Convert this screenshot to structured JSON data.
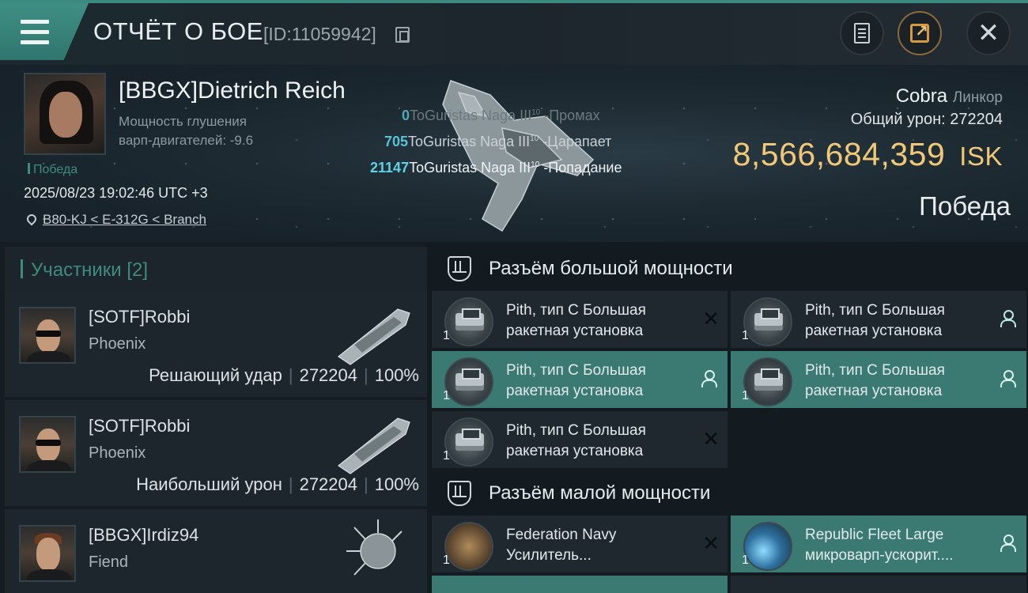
{
  "topbar": {
    "title": "ОТЧЁТ О БОЕ",
    "report_id": "[ID:11059942]"
  },
  "victim": {
    "name": "[BBGX]Dietrich Reich",
    "stat_label": "Мощность глушения",
    "stat_label_2": "варп-двигателей: -9.6",
    "result_tag": "Победа",
    "datetime": "2025/08/23 19:02:46 UTC +3",
    "location": "B80-KJ < E-312G < Branch",
    "ship_name": "Cobra",
    "ship_class": "Линкор",
    "total_damage_label": "Общий урон:",
    "total_damage": "272204",
    "isk_value": "8,566,684,359",
    "isk_unit": "ISK",
    "outcome": "Победа"
  },
  "hits": [
    {
      "damage": "0",
      "target": "ToGuristas Naga III",
      "level": "10",
      "result": "-Промах"
    },
    {
      "damage": "705",
      "target": "ToGuristas Naga III",
      "level": "10",
      "result": "-Царапает"
    },
    {
      "damage": "21147",
      "target": "ToGuristas Naga III",
      "level": "10",
      "result": "-Попадание"
    }
  ],
  "participants": {
    "header": "Участники [2]",
    "rows": [
      {
        "name": "[SOTF]Robbi",
        "ship": "Phoenix",
        "role": "Решающий удар",
        "damage": "272204",
        "percent": "100%"
      },
      {
        "name": "[SOTF]Robbi",
        "ship": "Phoenix",
        "role": "Наибольший урон",
        "damage": "272204",
        "percent": "100%"
      },
      {
        "name": "[BBGX]Irdiz94",
        "ship": "Fiend",
        "role": "",
        "damage": "",
        "percent": ""
      }
    ]
  },
  "fitting": {
    "high_slot_title": "Разъём большой мощности",
    "low_slot_title": "Разъём малой мощности",
    "high_modules": [
      {
        "qty": "1",
        "line1": "Pith, тип C Большая",
        "line2": "ракетная установка",
        "state": "destroyed",
        "icon": "launcher"
      },
      {
        "qty": "1",
        "line1": "Pith, тип C Большая",
        "line2": "ракетная установка",
        "state": "dropped",
        "icon": "launcher"
      },
      {
        "qty": "1",
        "line1": "Pith, тип C Большая",
        "line2": "ракетная установка",
        "state": "dropped",
        "icon": "launcher"
      },
      {
        "qty": "1",
        "line1": "Pith, тип C Большая",
        "line2": "ракетная установка",
        "state": "dropped",
        "icon": "launcher"
      },
      {
        "qty": "1",
        "line1": "Pith, тип C Большая",
        "line2": "ракетная установка",
        "state": "destroyed",
        "icon": "launcher"
      }
    ],
    "low_modules": [
      {
        "qty": "1",
        "line1": "Federation Navy",
        "line2": "Усилитель...",
        "state": "destroyed",
        "icon": "amp"
      },
      {
        "qty": "1",
        "line1": "Republic Fleet Large",
        "line2": "микроварп-ускорит....",
        "state": "dropped",
        "icon": "warp"
      }
    ]
  },
  "colors": {
    "accent_teal": "#3f8c7f",
    "isk_gold": "#f0c877",
    "active_module": "#3a7a72"
  }
}
